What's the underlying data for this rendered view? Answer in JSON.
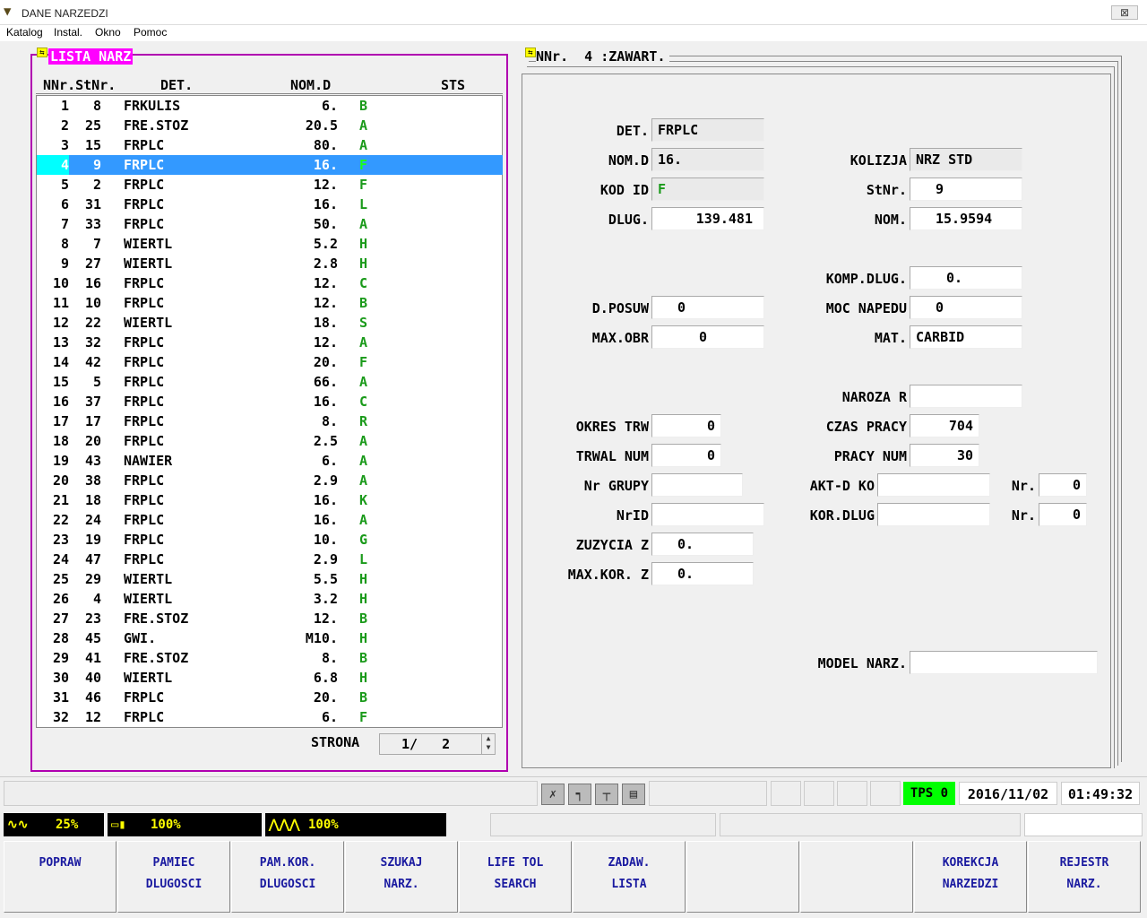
{
  "window": {
    "title": "DANE NARZEDZI",
    "close_label": "⊠"
  },
  "menu": [
    "Katalog",
    "Instal.",
    "Okno",
    "Pomoc"
  ],
  "list_panel": {
    "title": "LISTA NARZ",
    "headers": {
      "nnr_stnr": "NNr.StNr.",
      "det": "DET.",
      "nomd": "NOM.D",
      "sts": "STS"
    },
    "selected_index": 3,
    "rows": [
      {
        "nnr": "1",
        "stnr": "8",
        "det": "FRKULIS",
        "nomd": "6.",
        "sts": "B"
      },
      {
        "nnr": "2",
        "stnr": "25",
        "det": "FRE.STOZ",
        "nomd": "20.5",
        "sts": "A"
      },
      {
        "nnr": "3",
        "stnr": "15",
        "det": "FRPLC",
        "nomd": "80.",
        "sts": "A"
      },
      {
        "nnr": "4",
        "stnr": "9",
        "det": "FRPLC",
        "nomd": "16.",
        "sts": "F"
      },
      {
        "nnr": "5",
        "stnr": "2",
        "det": "FRPLC",
        "nomd": "12.",
        "sts": "F"
      },
      {
        "nnr": "6",
        "stnr": "31",
        "det": "FRPLC",
        "nomd": "16.",
        "sts": "L"
      },
      {
        "nnr": "7",
        "stnr": "33",
        "det": "FRPLC",
        "nomd": "50.",
        "sts": "A"
      },
      {
        "nnr": "8",
        "stnr": "7",
        "det": "WIERTL",
        "nomd": "5.2",
        "sts": "H"
      },
      {
        "nnr": "9",
        "stnr": "27",
        "det": "WIERTL",
        "nomd": "2.8",
        "sts": "H"
      },
      {
        "nnr": "10",
        "stnr": "16",
        "det": "FRPLC",
        "nomd": "12.",
        "sts": "C"
      },
      {
        "nnr": "11",
        "stnr": "10",
        "det": "FRPLC",
        "nomd": "12.",
        "sts": "B"
      },
      {
        "nnr": "12",
        "stnr": "22",
        "det": "WIERTL",
        "nomd": "18.",
        "sts": "S"
      },
      {
        "nnr": "13",
        "stnr": "32",
        "det": "FRPLC",
        "nomd": "12.",
        "sts": "A"
      },
      {
        "nnr": "14",
        "stnr": "42",
        "det": "FRPLC",
        "nomd": "20.",
        "sts": "F"
      },
      {
        "nnr": "15",
        "stnr": "5",
        "det": "FRPLC",
        "nomd": "66.",
        "sts": "A"
      },
      {
        "nnr": "16",
        "stnr": "37",
        "det": "FRPLC",
        "nomd": "16.",
        "sts": "C"
      },
      {
        "nnr": "17",
        "stnr": "17",
        "det": "FRPLC",
        "nomd": "8.",
        "sts": "R"
      },
      {
        "nnr": "18",
        "stnr": "20",
        "det": "FRPLC",
        "nomd": "2.5",
        "sts": "A"
      },
      {
        "nnr": "19",
        "stnr": "43",
        "det": "NAWIER",
        "nomd": "6.",
        "sts": "A"
      },
      {
        "nnr": "20",
        "stnr": "38",
        "det": "FRPLC",
        "nomd": "2.9",
        "sts": "A"
      },
      {
        "nnr": "21",
        "stnr": "18",
        "det": "FRPLC",
        "nomd": "16.",
        "sts": "K"
      },
      {
        "nnr": "22",
        "stnr": "24",
        "det": "FRPLC",
        "nomd": "16.",
        "sts": "A"
      },
      {
        "nnr": "23",
        "stnr": "19",
        "det": "FRPLC",
        "nomd": "10.",
        "sts": "G"
      },
      {
        "nnr": "24",
        "stnr": "47",
        "det": "FRPLC",
        "nomd": "2.9",
        "sts": "L"
      },
      {
        "nnr": "25",
        "stnr": "29",
        "det": "WIERTL",
        "nomd": "5.5",
        "sts": "H"
      },
      {
        "nnr": "26",
        "stnr": "4",
        "det": "WIERTL",
        "nomd": "3.2",
        "sts": "H"
      },
      {
        "nnr": "27",
        "stnr": "23",
        "det": "FRE.STOZ",
        "nomd": "12.",
        "sts": "B"
      },
      {
        "nnr": "28",
        "stnr": "45",
        "det": "GWI.",
        "nomd": "M10.",
        "sts": "H"
      },
      {
        "nnr": "29",
        "stnr": "41",
        "det": "FRE.STOZ",
        "nomd": "8.",
        "sts": "B"
      },
      {
        "nnr": "30",
        "stnr": "40",
        "det": "WIERTL",
        "nomd": "6.8",
        "sts": "H"
      },
      {
        "nnr": "31",
        "stnr": "46",
        "det": "FRPLC",
        "nomd": "20.",
        "sts": "B"
      },
      {
        "nnr": "32",
        "stnr": "12",
        "det": "FRPLC",
        "nomd": "6.",
        "sts": "F"
      }
    ],
    "page_label": "STRONA",
    "page_value": "1/   2"
  },
  "detail_panel": {
    "title": "NNr.  4 :ZAWART.",
    "fields": {
      "det": {
        "label": "DET.",
        "value": "FRPLC"
      },
      "nomd": {
        "label": "NOM.D",
        "value": "16."
      },
      "kod_id": {
        "label": "KOD ID",
        "value": "F"
      },
      "dlug": {
        "label": "DLUG.",
        "value": "139.481"
      },
      "kolizja": {
        "label": "KOLIZJA",
        "value": "NRZ STD"
      },
      "stnr": {
        "label": "StNr.",
        "value": "9"
      },
      "nom": {
        "label": "NOM.",
        "value": "15.9594"
      },
      "komp_dlug": {
        "label": "KOMP.DLUG.",
        "value": "0."
      },
      "d_posuw": {
        "label": "D.POSUW",
        "value": "0"
      },
      "moc_napedu": {
        "label": "MOC NAPEDU",
        "value": "0"
      },
      "max_obr": {
        "label": "MAX.OBR",
        "value": "0"
      },
      "mat": {
        "label": "MAT.",
        "value": "CARBID"
      },
      "naroza_r": {
        "label": "NAROZA R",
        "value": ""
      },
      "okres_trw": {
        "label": "OKRES TRW",
        "value": "0"
      },
      "czas_pracy": {
        "label": "CZAS PRACY",
        "value": "704"
      },
      "trwal_num": {
        "label": "TRWAL NUM",
        "value": "0"
      },
      "pracy_num": {
        "label": "PRACY NUM",
        "value": "30"
      },
      "nr_grupy": {
        "label": "Nr GRUPY",
        "value": ""
      },
      "akt_d_ko": {
        "label": "AKT-D KO",
        "value": ""
      },
      "nr1": {
        "label": "Nr.",
        "value": "0"
      },
      "nrid": {
        "label": "NrID",
        "value": ""
      },
      "kor_dlug": {
        "label": "KOR.DLUG",
        "value": ""
      },
      "nr2": {
        "label": "Nr.",
        "value": "0"
      },
      "zuzycia_z": {
        "label": "ZUZYCIA Z",
        "value": "0."
      },
      "max_kor_z": {
        "label": "MAX.KOR. Z",
        "value": "0."
      },
      "model_narz": {
        "label": "MODEL NARZ.",
        "value": ""
      }
    }
  },
  "status": {
    "tps": "TPS 0",
    "date": "2016/11/02",
    "time": "01:49:32",
    "spindle_override": "25%",
    "feed_override": "100%",
    "rapid_override": "100%",
    "status_color": "#00ff00"
  },
  "tool_icons": [
    "tool-change-icon",
    "tool-holder-icon",
    "tool-measure-icon",
    "tool-magazine-icon"
  ],
  "softkeys": [
    "POPRAW",
    "PAMIEC\nDLUGOSCI",
    "PAM.KOR.\nDLUGOSCI",
    "SZUKAJ\nNARZ.",
    "LIFE TOL\nSEARCH",
    "ZADAW.\nLISTA",
    "",
    "",
    "KOREKCJA\nNARZEDZI",
    "REJESTR\nNARZ."
  ]
}
